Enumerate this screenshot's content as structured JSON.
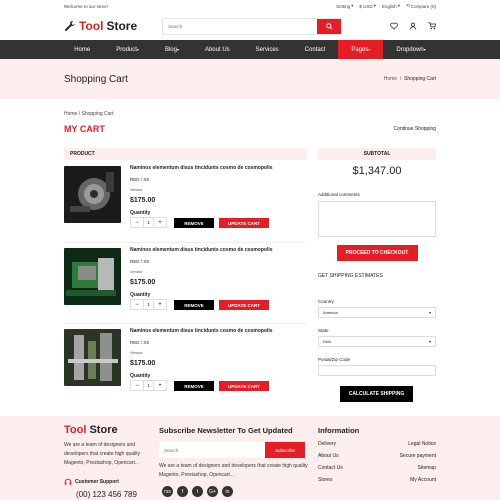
{
  "topbar": {
    "welcome": "Welcome to our store!",
    "setting": "Setting",
    "currency": "$ USD",
    "language": "English",
    "compare": "Compare (0)"
  },
  "logo": {
    "part1": "Tool",
    "part2": "Store"
  },
  "search": {
    "placeholder": "Search"
  },
  "nav": [
    {
      "label": "Home"
    },
    {
      "label": "Product"
    },
    {
      "label": "Blog"
    },
    {
      "label": "About Us"
    },
    {
      "label": "Services"
    },
    {
      "label": "Contact"
    },
    {
      "label": "Pages"
    },
    {
      "label": "Dropdown"
    }
  ],
  "page": {
    "title": "Shopping Cart",
    "crumb_home": "Home",
    "crumb_sep": "/",
    "crumb_current": "Shopping Cart"
  },
  "cart": {
    "path": "Home / Shopping Cart",
    "title": "MY CART",
    "continue": "Continue Shopping",
    "product_header": "PRODUCT",
    "items": [
      {
        "name": "Naminos elementum disus tincidunts cosmo de cosmopolis",
        "variant": "RED / XS",
        "vendor": "Vendor",
        "price": "$175.00",
        "qty_label": "Quantity",
        "qty": "1",
        "remove": "REMOVE",
        "update": "UPDATE CART"
      },
      {
        "name": "Naminos elementum disus tincidunts cosmo de cosmopolis",
        "variant": "RED / XS",
        "vendor": "Vendor",
        "price": "$175.00",
        "qty_label": "Quantity",
        "qty": "1",
        "remove": "REMOVE",
        "update": "UPDATE CART"
      },
      {
        "name": "Naminos elementum disus tincidunts cosmo de cosmopolis",
        "variant": "RED / XS",
        "vendor": "Vendor",
        "price": "$175.00",
        "qty_label": "Quantity",
        "qty": "1",
        "remove": "REMOVE",
        "update": "UPDATE CART"
      }
    ],
    "minus": "−",
    "plus": "+"
  },
  "summary": {
    "subtotal_label": "SUBTOTAL",
    "subtotal": "$1,347.00",
    "comments_label": "Additional comments",
    "checkout": "PROCEED TO CHECKOUT",
    "ship_title": "GET SHIPPING ESTIMATES",
    "country_label": "Country",
    "country": "America",
    "state_label": "State",
    "state": "Delo",
    "zip_label": "Postal/Zip Code",
    "calc": "CALCULATE SHIPPING"
  },
  "footer": {
    "logo1": "Tool",
    "logo2": "Store",
    "desc": "We are a team of designers and developers that create high quality Magento, Prestashop, Opencart...",
    "support": "Customer Support",
    "phone": "(00) 123 456 789",
    "news_title": "Subscribe Newsletter To Get Updated",
    "news_placeholder": "Search",
    "subscribe": "Subscribe",
    "news_desc": "We are a team of designers and developers that create high quality Magento, Prestashop, Opencart...",
    "social": [
      "rss",
      "f",
      "t",
      "G+",
      "in"
    ],
    "info_title": "Information",
    "links_left": [
      "Delivery",
      "About Us",
      "Contact Us",
      "Stores"
    ],
    "links_right": [
      "Legal Notice",
      "Secure payment",
      "Sitemap",
      "My Account"
    ]
  },
  "colors": {
    "accent": "#e31e24",
    "nav": "#333333",
    "tint": "#fdeeee"
  }
}
